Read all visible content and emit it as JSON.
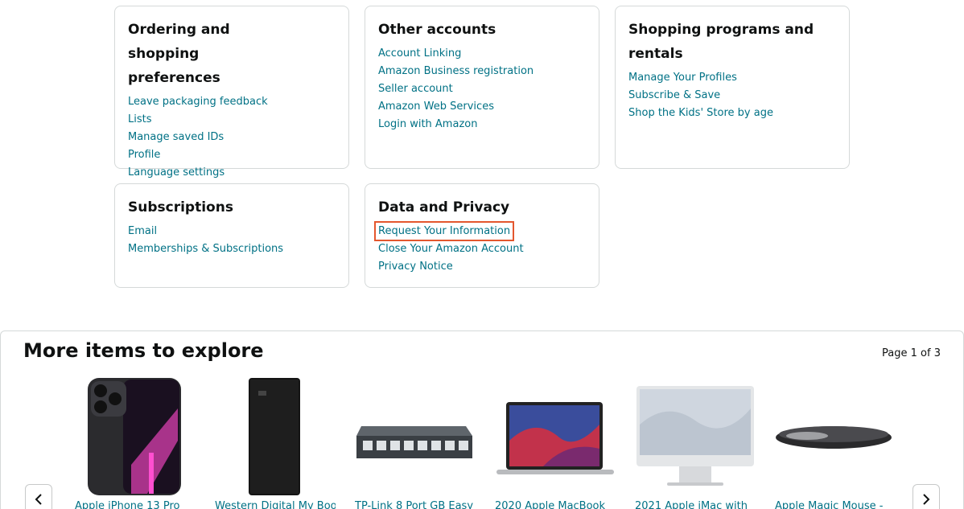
{
  "cards": {
    "ordering": {
      "title": "Ordering and shopping preferences",
      "links": [
        "Leave packaging feedback",
        "Lists",
        "Manage saved IDs",
        "Profile",
        "Language settings"
      ]
    },
    "other": {
      "title": "Other accounts",
      "links": [
        "Account Linking",
        "Amazon Business registration",
        "Seller account",
        "Amazon Web Services",
        "Login with Amazon"
      ]
    },
    "shopping": {
      "title": "Shopping programs and rentals",
      "links": [
        "Manage Your Profiles",
        "Subscribe & Save",
        "Shop the Kids' Store by age"
      ]
    },
    "subscriptions": {
      "title": "Subscriptions",
      "links": [
        "Email",
        "Memberships & Subscriptions"
      ]
    },
    "privacy": {
      "title": "Data and Privacy",
      "links": [
        "Request Your Information",
        "Close Your Amazon Account",
        "Privacy Notice"
      ]
    }
  },
  "explore": {
    "title": "More items to explore",
    "page": "Page 1 of 3",
    "products": [
      "Apple iPhone 13 Pro",
      "Western Digital My Book",
      "TP-Link 8 Port GB Easy",
      "2020 Apple MacBook",
      "2021 Apple iMac with",
      "Apple Magic Mouse -"
    ]
  },
  "icons": {
    "prev": "chevron-left-icon",
    "next": "chevron-right-icon"
  },
  "colors": {
    "link": "#007185",
    "highlight": "#e4572e",
    "border": "#d5d9d9"
  }
}
